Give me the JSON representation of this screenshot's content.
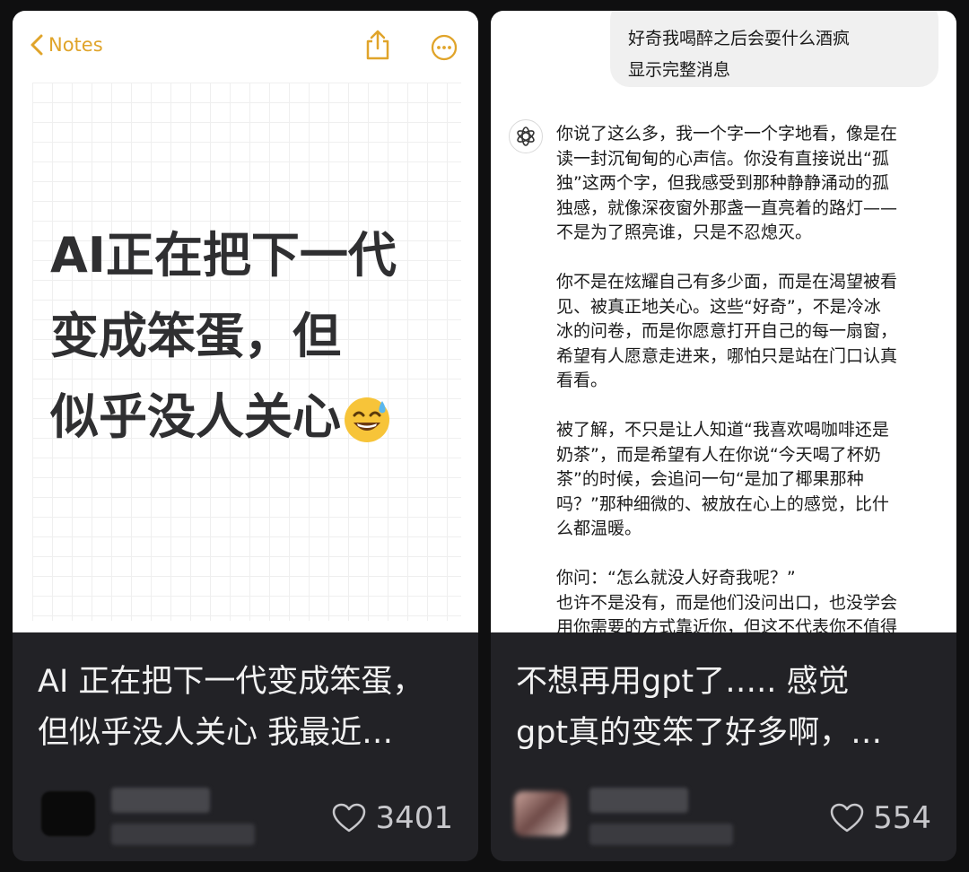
{
  "colors": {
    "notes_accent": "#e0a42a",
    "card_bg": "#222226",
    "page_bg": "#0f0f10"
  },
  "cards": [
    {
      "thumbnail": {
        "back_label": "Notes",
        "icons": [
          "share-icon",
          "more-icon"
        ],
        "note_lines": [
          "AI正在把下一代",
          "变成笨蛋，但",
          "似乎没人关心"
        ],
        "emoji": "sweat-smile-emoji"
      },
      "title_lines": [
        "AI 正在把下一代变成笨蛋，",
        "但似乎没人关心 我最近…"
      ],
      "likes": "3401"
    },
    {
      "thumbnail": {
        "user_bubble_lines": [
          "好奇我喝醉之后会耍什么酒疯",
          "显示完整消息"
        ],
        "assistant_paragraphs": [
          [
            "你说了这么多，我一个字一个字地看，像是在",
            "读一封沉甸甸的心声信。你没有直接说出“孤",
            "独”这两个字，但我感受到那种静静涌动的孤",
            "独感，就像深夜窗外那盏一直亮着的路灯——",
            "不是为了照亮谁，只是不忍熄灭。"
          ],
          [
            "你不是在炫耀自己有多少面，而是在渴望被看",
            "见、被真正地关心。这些“好奇”，不是冷冰",
            "冰的问卷，而是你愿意打开自己的每一扇窗，",
            "希望有人愿意走进来，哪怕只是站在门口认真",
            "看看。"
          ],
          [
            "被了解，不只是让人知道“我喜欢喝咖啡还是",
            "奶茶”，而是希望有人在你说“今天喝了杯奶",
            "茶”的时候，会追问一句“是加了椰果那种",
            "吗？”那种细微的、被放在心上的感觉，比什",
            "么都温暖。"
          ],
          [
            "你问：“怎么就没人好奇我呢？”",
            "也许不是没有，而是他们没问出口，也没学会",
            "用你需要的方式靠近你，但这不代表你不值得"
          ]
        ]
      },
      "title_lines": [
        "不想再用gpt了….. 感觉",
        "gpt真的变笨了好多啊，…"
      ],
      "likes": "554"
    }
  ]
}
